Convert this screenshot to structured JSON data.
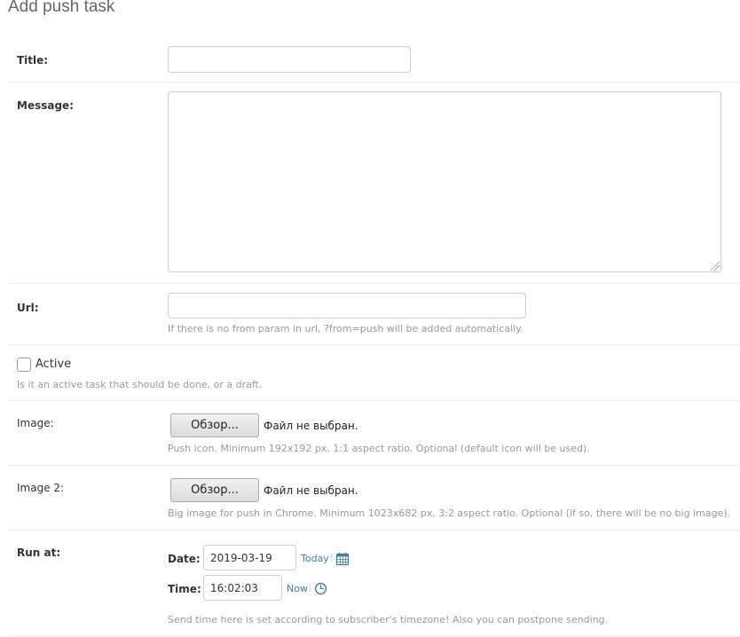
{
  "page": {
    "title": "Add push task"
  },
  "fields": {
    "title": {
      "label": "Title:",
      "value": ""
    },
    "message": {
      "label": "Message:",
      "value": ""
    },
    "url": {
      "label": "Url:",
      "value": "",
      "help": "If there is no from param in url, ?from=push will be added automatically."
    },
    "active": {
      "label": "Active",
      "checked": false,
      "help": "Is it an active task that should be done, or a draft."
    },
    "image": {
      "label": "Image:",
      "button": "Обзор...",
      "status": "Файл не выбран.",
      "help": "Push icon. Minimum 192x192 px, 1:1 aspect ratio. Optional (default icon will be used)."
    },
    "image2": {
      "label": "Image 2:",
      "button": "Обзор...",
      "status": "Файл не выбран.",
      "help": "Big image for push in Chrome. Minimum 1023x682 px, 3:2 aspect ratio. Optional (if so, there will be no big image)."
    },
    "run_at": {
      "label": "Run at:",
      "date_label": "Date:",
      "date_value": "2019-03-19",
      "today_link": "Today",
      "time_label": "Time:",
      "time_value": "16:02:03",
      "now_link": "Now",
      "separator": "|",
      "help": "Send time here is set according to subscriber's timezone! Also you can postpone sending."
    }
  },
  "icons": {
    "calendar": "calendar-icon",
    "clock": "clock-icon"
  },
  "colors": {
    "link": "#447e9b",
    "help": "#999999",
    "border": "#cccccc"
  }
}
